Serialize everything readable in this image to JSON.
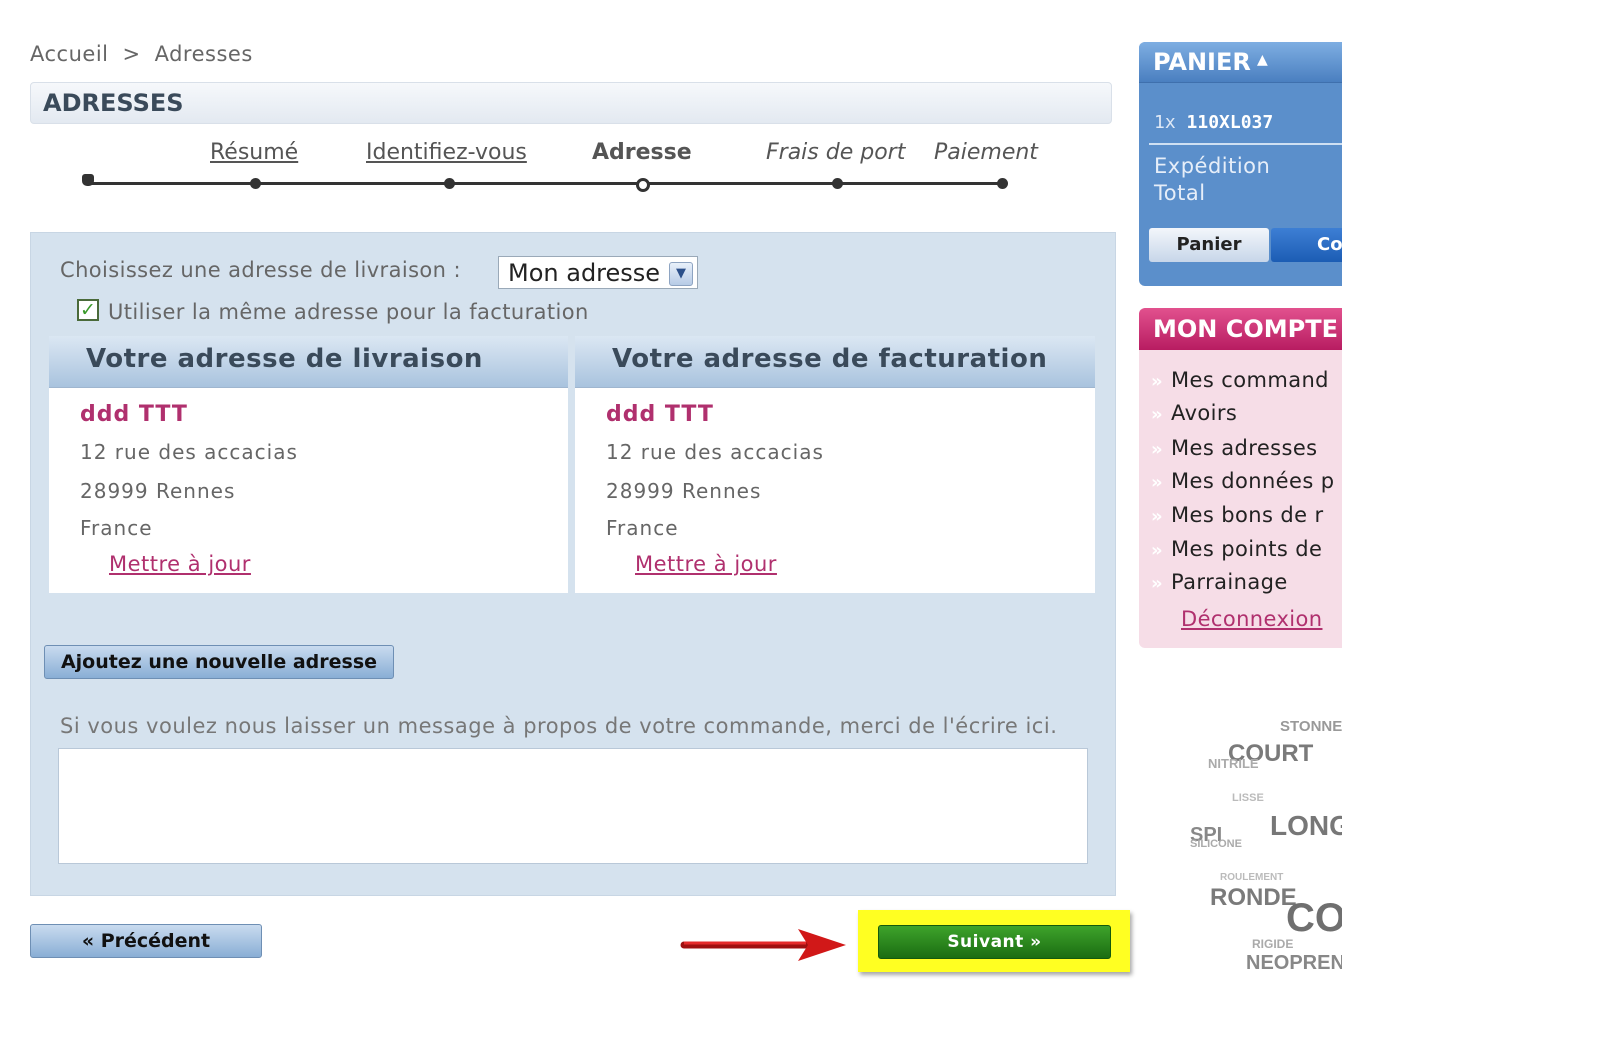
{
  "breadcrumb": {
    "home": "Accueil",
    "separator": ">",
    "current": "Adresses"
  },
  "page_title": "ADRESSES",
  "steps": [
    {
      "label": "Résumé",
      "state": "done"
    },
    {
      "label": "Identifiez-vous",
      "state": "done"
    },
    {
      "label": "Adresse",
      "state": "current"
    },
    {
      "label": "Frais de port",
      "state": "todo"
    },
    {
      "label": "Paiement",
      "state": "todo"
    }
  ],
  "address_form": {
    "choose_label": "Choisissez une adresse de livraison :",
    "selected_address": "Mon adresse",
    "same_address_checked": true,
    "same_address_label": "Utiliser la même adresse pour la facturation"
  },
  "delivery": {
    "heading": "Votre adresse de livraison",
    "name": "ddd TTT",
    "street": "12 rue des accacias",
    "city": "28999 Rennes",
    "country": "France",
    "update_label": "Mettre à jour"
  },
  "billing": {
    "heading": "Votre adresse de facturation",
    "name": "ddd TTT",
    "street": "12 rue des accacias",
    "city": "28999 Rennes",
    "country": "France",
    "update_label": "Mettre à jour"
  },
  "add_address_label": "Ajoutez une nouvelle adresse",
  "message": {
    "label": "Si vous voulez nous laisser un message à propos de votre commande, merci de l'écrire ici.",
    "value": ""
  },
  "nav": {
    "prev_label": "« Précédent",
    "next_label": "Suivant »"
  },
  "panier": {
    "title": "PANIER",
    "caret": "▲",
    "item_qty": "1x",
    "item_ref": "110XL037",
    "shipping_label": "Expédition",
    "total_label": "Total",
    "cart_button": "Panier",
    "checkout_button": "Co"
  },
  "account": {
    "title": "MON COMPTE",
    "items": [
      "Mes command",
      "Avoirs",
      "Mes adresses",
      "Mes données p",
      "Mes bons de r",
      "Mes points de",
      "Parrainage"
    ],
    "logout": "Déconnexion"
  },
  "tag_cloud": [
    "STONNE",
    "COURT",
    "NITRILE",
    "LISSE",
    "LONG",
    "SPI",
    "SILICONE",
    "ROULEMENT",
    "RONDE",
    "CO",
    "RIGIDE",
    "NEOPREN"
  ],
  "colors": {
    "accent_pink": "#b0306e",
    "panier_blue": "#5b8fcb",
    "next_green": "#2a8a1d",
    "highlight_yellow": "#ffff22",
    "arrow_red": "#d11818"
  }
}
